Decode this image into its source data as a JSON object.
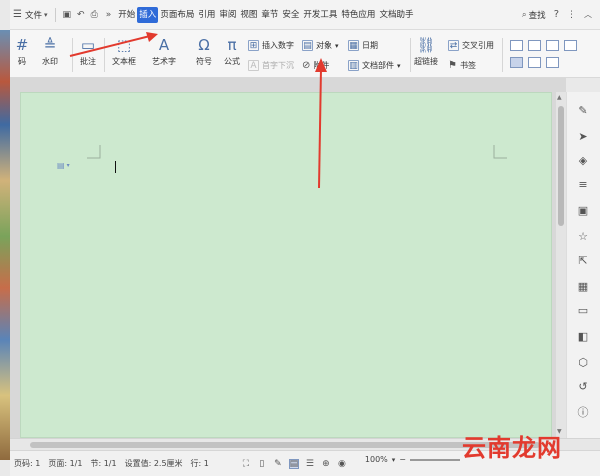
{
  "menubar": {
    "file_menu": "文件",
    "tabs": [
      "开始",
      "插入",
      "页面布局",
      "引用",
      "审阅",
      "视图",
      "章节",
      "安全",
      "开发工具",
      "特色应用",
      "文档助手"
    ],
    "active_tab_index": 1,
    "search_label": "查找",
    "help": "?"
  },
  "ribbon": {
    "page_number": "码",
    "watermark": "水印",
    "comment": "批注",
    "textbox": "文本框",
    "wordart": "艺术字",
    "symbol": "符号",
    "formula": "公式",
    "insert_number": "插入数字",
    "first_line_indent": "首字下沉",
    "object": "对象",
    "attachment": "附件",
    "date": "日期",
    "doc_parts": "文档部件",
    "hyperlink": "超链接",
    "cross_ref": "交叉引用",
    "bookmark": "书签"
  },
  "statusbar": {
    "page_no": "页码: 1",
    "page_total": "页面: 1/1",
    "section": "节: 1/1",
    "setting": "设置值: 2.5厘米",
    "row": "行: 1",
    "zoom": "100%"
  },
  "watermark_text": "云南龙网",
  "colors": {
    "accent": "#2f6bd8",
    "page_bg": "#cde9cf",
    "arrow": "#e23a2e"
  }
}
